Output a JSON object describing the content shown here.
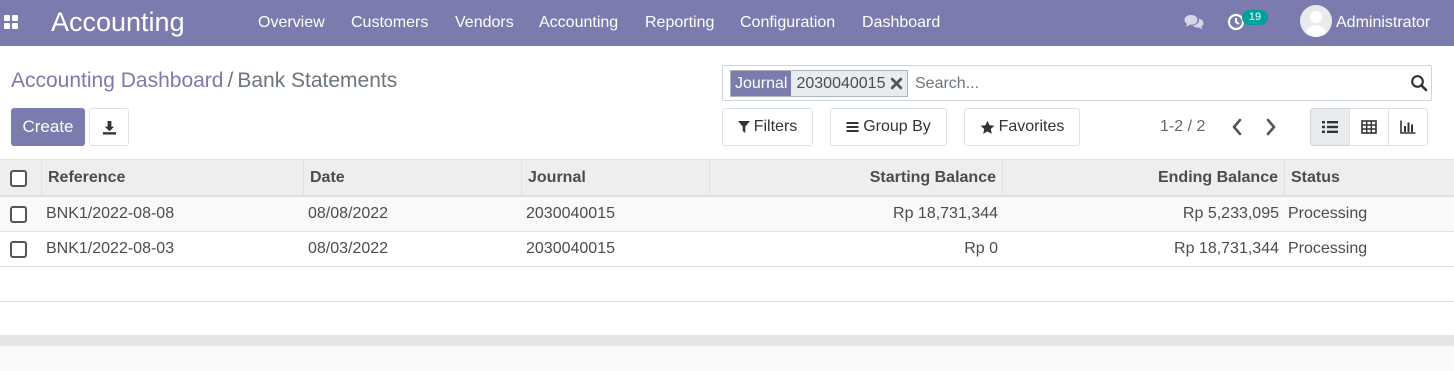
{
  "app": {
    "title": "Accounting"
  },
  "nav": {
    "items": [
      "Overview",
      "Customers",
      "Vendors",
      "Accounting",
      "Reporting",
      "Configuration",
      "Dashboard"
    ],
    "activity_count": "19",
    "user_name": "Administrator"
  },
  "breadcrumb": {
    "parent": "Accounting Dashboard",
    "separator": "/",
    "current": "Bank Statements"
  },
  "toolbar": {
    "create_label": "Create"
  },
  "search": {
    "facet_category": "Journal",
    "facet_value": "2030040015",
    "placeholder": "Search..."
  },
  "options": {
    "filters": "Filters",
    "group_by": "Group By",
    "favorites": "Favorites"
  },
  "pager": {
    "text": "1-2 / 2"
  },
  "table": {
    "columns": [
      "Reference",
      "Date",
      "Journal",
      "Starting Balance",
      "Ending Balance",
      "Status"
    ],
    "rows": [
      [
        "BNK1/2022-08-08",
        "08/08/2022",
        "2030040015",
        "Rp 18,731,344",
        "Rp 5,233,095",
        "Processing"
      ],
      [
        "BNK1/2022-08-03",
        "08/03/2022",
        "2030040015",
        "Rp 0",
        "Rp 18,731,344",
        "Processing"
      ]
    ]
  },
  "colors": {
    "brand": "#7c7bad",
    "badge": "#00a09d"
  }
}
